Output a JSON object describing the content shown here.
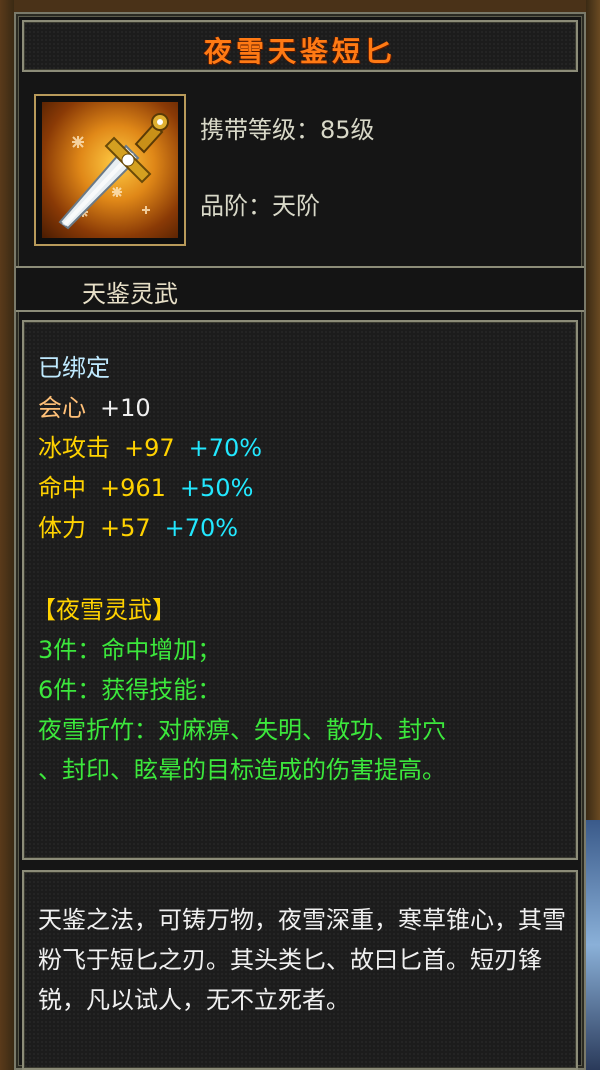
{
  "item": {
    "name": "夜雪天鉴短匕",
    "name_color": "#ff7a14",
    "icon": "dagger-icon",
    "carry_level": "携带等级：85级",
    "grade": "品阶：天阶",
    "subtitle": "天鉴灵武"
  },
  "stats": {
    "bound": "已绑定",
    "lines": [
      {
        "name": "会心",
        "base": "+10",
        "bonus": ""
      },
      {
        "name": "冰攻击",
        "base": "+97",
        "bonus": "+70%"
      },
      {
        "name": "命中",
        "base": "+961",
        "bonus": "+50%"
      },
      {
        "name": "体力",
        "base": "+57",
        "bonus": "+70%"
      }
    ]
  },
  "set": {
    "title": "【夜雪灵武】",
    "piece3": "3件：命中增加；",
    "piece6": "6件：获得技能：",
    "skill_line1": "夜雪折竹：对麻痹、失明、散功、封穴",
    "skill_line2": "、封印、眩晕的目标造成的伤害提高。"
  },
  "description": "天鉴之法，可铸万物，夜雪深重，寒草锥心，其雪粉飞于短匕之刃。其头类匕、故曰匕首。短刃锋锐，凡以试人，无不立死者。"
}
